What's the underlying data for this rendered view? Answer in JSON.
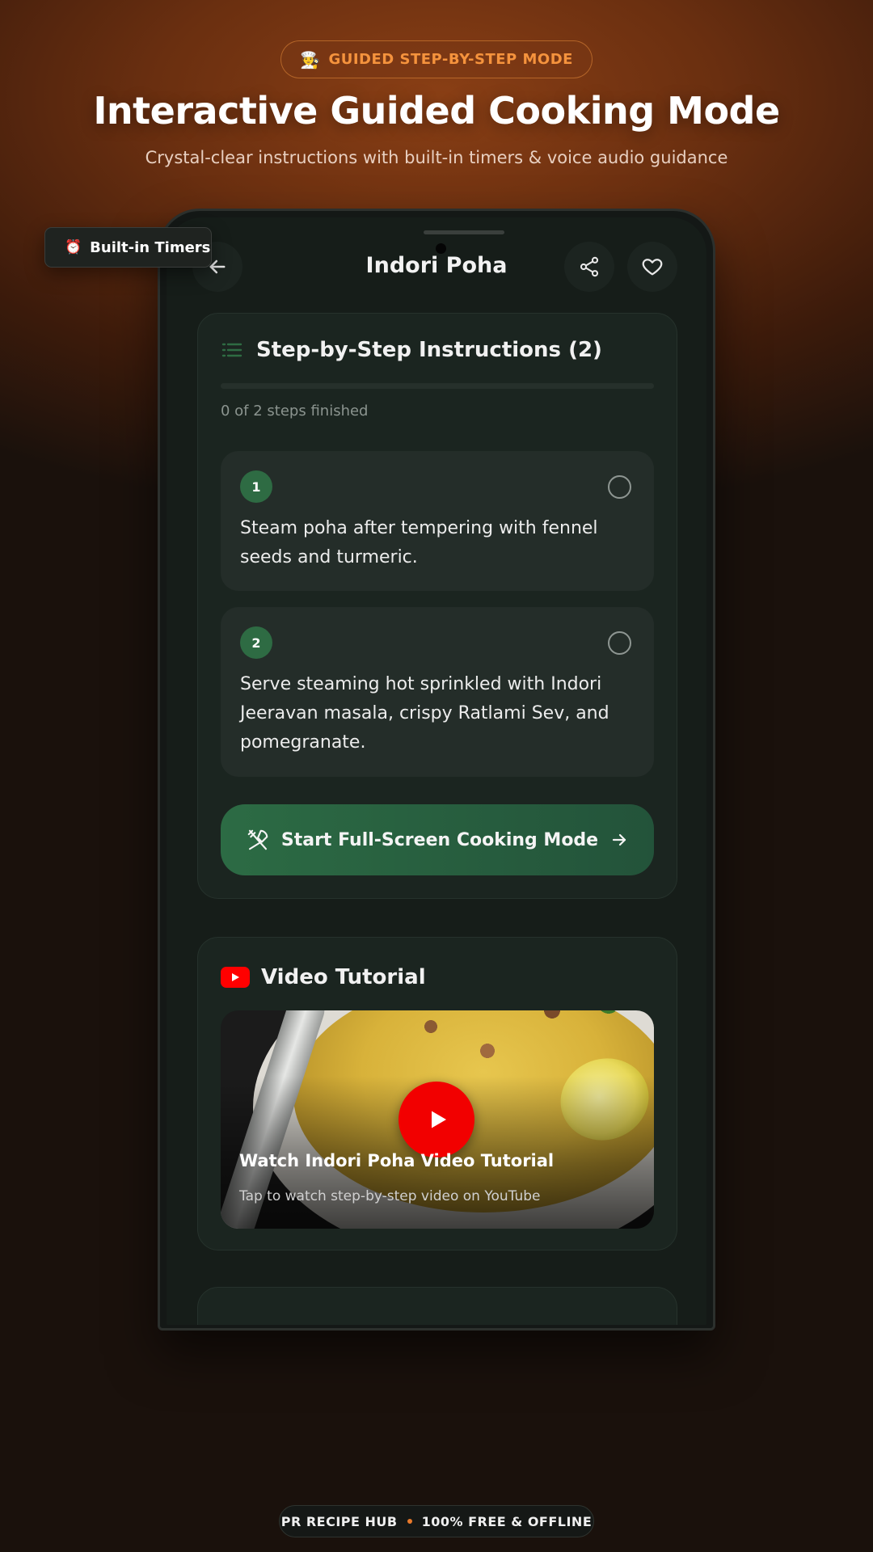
{
  "hero": {
    "badge_emoji": "🧑‍🍳",
    "badge_label": "GUIDED STEP-BY-STEP MODE",
    "title": "Interactive Guided Cooking Mode",
    "subtitle": "Crystal-clear instructions with built-in timers & voice audio guidance"
  },
  "floating_badge": {
    "emoji": "⏰",
    "label": "Built-in Timers"
  },
  "app": {
    "title": "Indori Poha",
    "icons": {
      "back": "arrow-left-icon",
      "share": "share-icon",
      "favorite": "heart-icon"
    }
  },
  "instructions": {
    "title": "Step-by-Step Instructions (2)",
    "progress_text": "0 of 2 steps finished",
    "progress_fraction": 0,
    "steps": [
      {
        "number": "1",
        "text": "Steam poha after tempering with fennel seeds and turmeric.",
        "done": false
      },
      {
        "number": "2",
        "text": "Serve steaming hot sprinkled with Indori Jeeravan masala, crispy Ratlami Sev, and pomegranate.",
        "done": false
      }
    ],
    "cook_button": "Start Full-Screen Cooking Mode"
  },
  "video": {
    "title": "Video Tutorial",
    "thumbnail_title": "Watch Indori Poha Video Tutorial",
    "thumbnail_subtitle": "Tap to watch step-by-step video on YouTube"
  },
  "footer": {
    "brand": "PR RECIPE HUB",
    "tagline": "100% FREE & OFFLINE"
  },
  "colors": {
    "accent_green": "#2e6b43",
    "badge_orange": "#f5933d",
    "youtube_red": "#ff0000"
  }
}
